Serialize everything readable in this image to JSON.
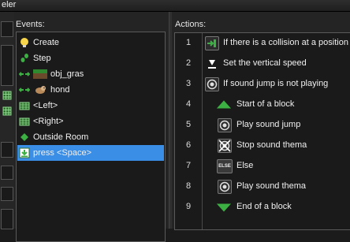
{
  "window": {
    "title": "eler"
  },
  "events": {
    "label": "Events:",
    "items": [
      {
        "label": "Create",
        "icon": "bulb-icon"
      },
      {
        "label": "Step",
        "icon": "footsteps-icon"
      },
      {
        "label": "obj_gras",
        "icon": "collision-grass-icon"
      },
      {
        "label": "hond",
        "icon": "collision-dog-icon"
      },
      {
        "label": "<Left>",
        "icon": "keyboard-icon"
      },
      {
        "label": "<Right>",
        "icon": "keyboard-icon"
      },
      {
        "label": "Outside Room",
        "icon": "diamond-icon"
      },
      {
        "label": "press <Space>",
        "icon": "key-press-icon",
        "selected": true
      }
    ]
  },
  "actions": {
    "label": "Actions:",
    "items": [
      {
        "num": "1",
        "label": "If there is a collision at a position",
        "icon": "collision-check-icon"
      },
      {
        "num": "2",
        "label": "Set the vertical speed",
        "icon": "vertical-speed-icon"
      },
      {
        "num": "3",
        "label": "If sound jump is not playing",
        "icon": "sound-check-icon"
      },
      {
        "num": "4",
        "label": "Start of a block",
        "icon": "block-start-icon"
      },
      {
        "num": "5",
        "label": "Play sound jump",
        "icon": "play-sound-icon"
      },
      {
        "num": "6",
        "label": "Stop sound thema",
        "icon": "stop-sound-icon"
      },
      {
        "num": "7",
        "label": "Else",
        "icon": "else-icon",
        "badge": "ELSE"
      },
      {
        "num": "8",
        "label": "Play sound thema",
        "icon": "play-sound-icon"
      },
      {
        "num": "9",
        "label": "End of a block",
        "icon": "block-end-icon"
      }
    ]
  },
  "colors": {
    "selection": "#3a8ee6",
    "green": "#3cb043"
  }
}
